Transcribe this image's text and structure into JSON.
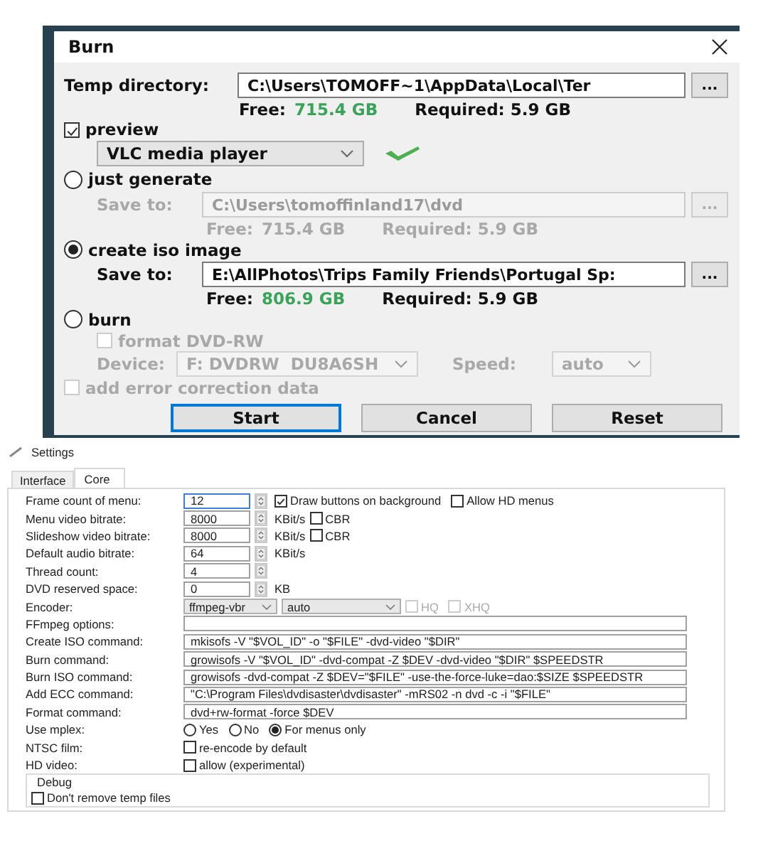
{
  "burn": {
    "title": "Burn",
    "temp": {
      "label": "Temp directory:",
      "value": "C:\\Users\\TOMOFF~1\\AppData\\Local\\Ter",
      "browse": "..."
    },
    "temp_space": {
      "free_label": "Free:",
      "free": "715.4 GB",
      "required": "Required: 5.9 GB"
    },
    "preview": {
      "label": "preview",
      "checked": true,
      "player": "VLC media player",
      "player_ok": true
    },
    "modes": [
      {
        "kind": "save",
        "label": "just generate",
        "selected": false,
        "disabled": true,
        "save_label": "Save to:",
        "value": "C:\\Users\\tomoffinland17\\dvd",
        "browse": "...",
        "free_label": "Free:",
        "free": "715.4 GB",
        "required": "Required: 5.9 GB"
      },
      {
        "kind": "save",
        "label": "create iso image",
        "selected": true,
        "disabled": false,
        "save_label": "Save to:",
        "value": "E:\\AllPhotos\\Trips Family Friends\\Portugal Sp:",
        "browse": "...",
        "free_label": "Free:",
        "free": "806.9 GB",
        "required": "Required: 5.9 GB"
      },
      {
        "kind": "burn",
        "label": "burn",
        "selected": false,
        "disabled": true,
        "format": {
          "label": "format DVD-RW",
          "checked": false
        },
        "device_label": "Device:",
        "device": "F: DVDRW  DU8A6SH",
        "speed_label": "Speed:",
        "speed": "auto"
      }
    ],
    "ecc": {
      "label": "add error correction data",
      "checked": false,
      "disabled": true
    },
    "buttons": [
      {
        "label": "Start",
        "focused": true
      },
      {
        "label": "Cancel",
        "focused": false
      },
      {
        "label": "Reset",
        "focused": false
      }
    ]
  },
  "settings": {
    "title": "Settings",
    "tabs": [
      {
        "label": "Interface",
        "selected": false
      },
      {
        "label": "Core",
        "selected": true
      }
    ],
    "rows": [
      {
        "kind": "spin",
        "label": "Frame count of menu:",
        "value": "12",
        "focused": true,
        "checks": [
          {
            "label": "Draw buttons on background",
            "checked": true,
            "disabled": false
          },
          {
            "label": "Allow HD menus",
            "checked": false,
            "disabled": false
          }
        ]
      },
      {
        "kind": "spin",
        "label": "Menu video bitrate:",
        "value": "8000",
        "focused": false,
        "unit": "KBit/s",
        "checks": [
          {
            "label": "CBR",
            "checked": false,
            "disabled": false
          }
        ]
      },
      {
        "kind": "spin",
        "label": "Slideshow video bitrate:",
        "value": "8000",
        "focused": false,
        "unit": "KBit/s",
        "checks": [
          {
            "label": "CBR",
            "checked": false,
            "disabled": false
          }
        ]
      },
      {
        "kind": "spin",
        "label": "Default audio bitrate:",
        "value": "64",
        "focused": false,
        "unit": "KBit/s"
      },
      {
        "kind": "spin",
        "label": "Thread count:",
        "value": "4",
        "focused": false
      },
      {
        "kind": "spin",
        "label": "DVD reserved space:",
        "value": "0",
        "focused": false,
        "unit": "KB"
      },
      {
        "kind": "combo",
        "label": "Encoder:",
        "combos": [
          "ffmpeg-vbr",
          "auto"
        ],
        "checks": [
          {
            "label": "HQ",
            "checked": false,
            "disabled": true
          },
          {
            "label": "XHQ",
            "checked": false,
            "disabled": true
          }
        ]
      },
      {
        "kind": "text",
        "label": "FFmpeg options:"
      },
      {
        "kind": "text",
        "label": "Create ISO command:",
        "value": "mkisofs -V \"$VOL_ID\" -o \"$FILE\" -dvd-video \"$DIR\""
      },
      {
        "kind": "text",
        "label": "Burn command:",
        "value": "growisofs -V \"$VOL_ID\" -dvd-compat -Z $DEV -dvd-video \"$DIR\" $SPEEDSTR"
      },
      {
        "kind": "text",
        "label": "Burn ISO command:",
        "value": "growisofs -dvd-compat -Z $DEV=\"$FILE\" -use-the-force-luke=dao:$SIZE $SPEEDSTR"
      },
      {
        "kind": "text",
        "label": "Add ECC command:",
        "value": "\"C:\\Program Files\\dvdisaster\\dvdisaster\" -mRS02 -n dvd -c -i \"$FILE\""
      },
      {
        "kind": "text",
        "label": "Format command:",
        "value": "dvd+rw-format -force $DEV"
      },
      {
        "kind": "radio",
        "label": "Use mplex:",
        "options": [
          {
            "label": "Yes",
            "selected": false
          },
          {
            "label": "No",
            "selected": false
          },
          {
            "label": "For menus only",
            "selected": true
          }
        ]
      },
      {
        "kind": "check",
        "label": "NTSC film:",
        "checks": [
          {
            "label": "re-encode by default",
            "checked": false,
            "disabled": false
          }
        ]
      },
      {
        "kind": "check",
        "label": "HD video:",
        "checks": [
          {
            "label": "allow (experimental)",
            "checked": false,
            "disabled": false
          }
        ]
      }
    ],
    "debug": {
      "title": "Debug",
      "checks": [
        {
          "label": "Don't remove temp files",
          "checked": false,
          "disabled": false
        }
      ]
    }
  }
}
